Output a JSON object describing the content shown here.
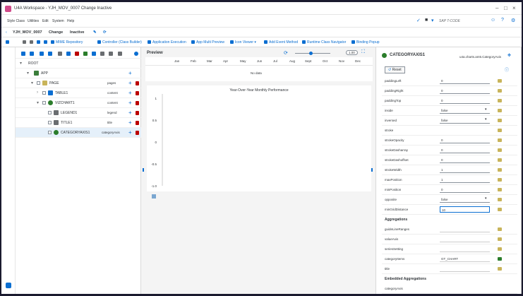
{
  "window": {
    "title": "U4A Workspace - YJH_MOV_0007 Change Inactive"
  },
  "menu": {
    "items": [
      "Style Class",
      "Utilities",
      "Edit",
      "System",
      "Help"
    ],
    "sap_code": "SAP T-CODE"
  },
  "nav": {
    "app_id": "YJH_MOV_0007",
    "mode": "Change",
    "status": "Inactive"
  },
  "toolbar": {
    "buttons": [
      "MIME Repository",
      "Controller (Class Builder)",
      "Application Execution",
      "App Multi Preview",
      "Icon Viewer",
      "Add Event Method",
      "Runtime Class Navigator",
      "Binding Popup"
    ]
  },
  "tree": {
    "rows": [
      {
        "label": "ROOT",
        "agg": ""
      },
      {
        "label": "APP",
        "agg": ""
      },
      {
        "label": "PAGE",
        "agg": "pages"
      },
      {
        "label": "TABLE1",
        "agg": "content"
      },
      {
        "label": "VIZCHART1",
        "agg": "content"
      },
      {
        "label": "LEGEND1",
        "agg": "legend"
      },
      {
        "label": "TITLE1",
        "agg": "title"
      },
      {
        "label": "CATEGORYAXIS1",
        "agg": "categoryAxis"
      }
    ]
  },
  "preview": {
    "title": "Preview",
    "months": [
      "Jan",
      "Feb",
      "Mar",
      "Apr",
      "May",
      "Jun",
      "Jul",
      "Aug",
      "Sept",
      "Oct",
      "Nov",
      "Dec"
    ],
    "no_data": "No data",
    "zoom": "1.00",
    "chart_title": "Year-Over-Year Monthly Performance",
    "yticks": [
      "1",
      "0.5",
      "0",
      "-0.5",
      "-1.0"
    ]
  },
  "chart_data": {
    "type": "line",
    "title": "Year-Over-Year Monthly Performance",
    "categories": [],
    "series": [],
    "ylim": [
      -1.0,
      1.0
    ],
    "yticks": [
      1,
      0.5,
      0,
      -0.5,
      -1.0
    ]
  },
  "props": {
    "header": "CATEGORYAXIS1",
    "class": "u4a.charts.am5.CategoryAxis",
    "reset": "Reset",
    "rows": [
      {
        "label": "paddingLeft",
        "value": "0",
        "type": "input"
      },
      {
        "label": "paddingRight",
        "value": "0",
        "type": "input"
      },
      {
        "label": "paddingTop",
        "value": "0",
        "type": "input"
      },
      {
        "label": "inside",
        "value": "false",
        "type": "select"
      },
      {
        "label": "inversed",
        "value": "false",
        "type": "select"
      },
      {
        "label": "stroke",
        "value": "",
        "type": "none"
      },
      {
        "label": "strokeOpacity",
        "value": "0",
        "type": "input"
      },
      {
        "label": "strokeDasharray",
        "value": "0",
        "type": "input"
      },
      {
        "label": "strokeDashoffset",
        "value": "0",
        "type": "input"
      },
      {
        "label": "strokeWidth",
        "value": "1",
        "type": "input"
      },
      {
        "label": "maxPosition",
        "value": "1",
        "type": "input"
      },
      {
        "label": "minPosition",
        "value": "0",
        "type": "input"
      },
      {
        "label": "opposite",
        "value": "false",
        "type": "select"
      },
      {
        "label": "minGridDistance",
        "value": "10",
        "type": "active"
      }
    ],
    "aggregations_title": "Aggregations",
    "aggregations": [
      {
        "label": "guideLineRanges",
        "value": ""
      },
      {
        "label": "valueAxis",
        "value": ""
      },
      {
        "label": "seriesSetting",
        "value": ""
      },
      {
        "label": "categoryItems",
        "value": "GT_CHART"
      },
      {
        "label": "title",
        "value": ""
      }
    ],
    "embedded_title": "Embedded Aggregations",
    "embedded": [
      {
        "label": "categoryAxis"
      }
    ]
  }
}
